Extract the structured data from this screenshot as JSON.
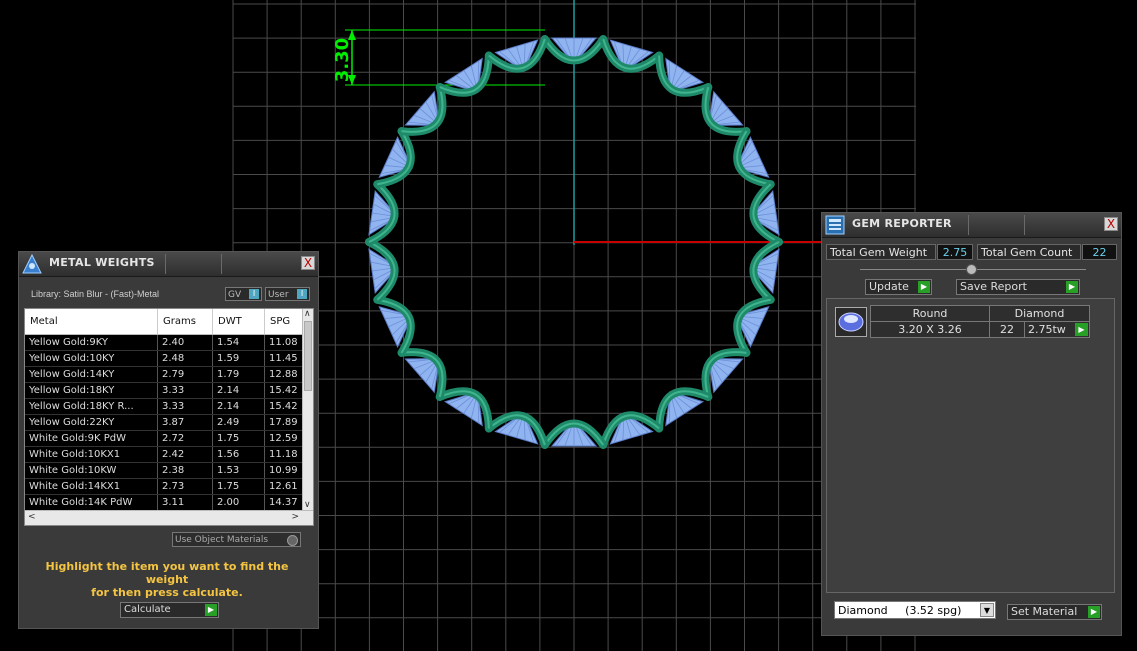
{
  "viewport": {
    "dimension_label": "3.30",
    "colors": {
      "grid": "#4a4a4a",
      "axis_x": "#c80000",
      "axis_y": "#1aa0a0",
      "dimension": "#00ee00",
      "metal": "#1e8a6a",
      "gem": "#8fb4f0"
    }
  },
  "metal_weights": {
    "title": "METAL WEIGHTS",
    "library_label": "Library: Satin Blur - (Fast)-Metal",
    "gv_label": "GV",
    "user_label": "User",
    "toggle_knob": "I",
    "columns": [
      "Metal",
      "Grams",
      "DWT",
      "SPG"
    ],
    "rows": [
      [
        "Yellow Gold:9KY",
        "2.40",
        "1.54",
        "11.08"
      ],
      [
        "Yellow Gold:10KY",
        "2.48",
        "1.59",
        "11.45"
      ],
      [
        "Yellow Gold:14KY",
        "2.79",
        "1.79",
        "12.88"
      ],
      [
        "Yellow Gold:18KY",
        "3.33",
        "2.14",
        "15.42"
      ],
      [
        "Yellow Gold:18KY R...",
        "3.33",
        "2.14",
        "15.42"
      ],
      [
        "Yellow Gold:22KY",
        "3.87",
        "2.49",
        "17.89"
      ],
      [
        "White Gold:9K PdW",
        "2.72",
        "1.75",
        "12.59"
      ],
      [
        "White Gold:10KX1",
        "2.42",
        "1.56",
        "11.18"
      ],
      [
        "White Gold:10KW",
        "2.38",
        "1.53",
        "10.99"
      ],
      [
        "White Gold:14KX1",
        "2.73",
        "1.75",
        "12.61"
      ],
      [
        "White Gold:14K PdW",
        "3.11",
        "2.00",
        "14.37"
      ]
    ],
    "use_object_materials": "Use Object Materials",
    "hint_line1": "Highlight the item you want to find the weight",
    "hint_line2": "for then press calculate.",
    "calculate_label": "Calculate",
    "close": "X"
  },
  "gem_reporter": {
    "title": "GEM REPORTER",
    "total_weight_label": "Total Gem Weight",
    "total_weight_value": "2.75",
    "total_count_label": "Total Gem Count",
    "total_count_value": "22",
    "update_label": "Update",
    "save_report_label": "Save Report",
    "gem_header_cut": "Round",
    "gem_header_type": "Diamond",
    "gem_size": "3.20 X 3.26",
    "gem_count": "22",
    "gem_weight": "2.75tw",
    "material_select": "Diamond     (3.52 spg)",
    "set_material_label": "Set Material",
    "close": "X"
  }
}
